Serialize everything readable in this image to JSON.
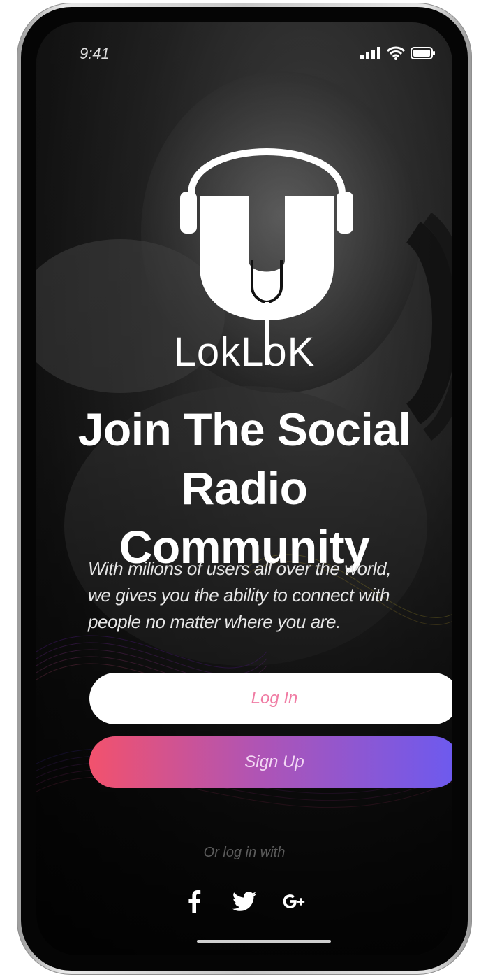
{
  "status_bar": {
    "time": "9:41",
    "icons": [
      "signal-icon",
      "wifi-icon",
      "battery-icon"
    ]
  },
  "logo": {
    "brand_name": "LokLoK",
    "icon": "headphones-microphone-logo"
  },
  "headline": {
    "line1": "Join The Social",
    "line2": "Radio Community"
  },
  "description": "With milions of users all over the world, we gives you the ability to connect with people no matter where you are.",
  "buttons": {
    "login_label": "Log In",
    "signup_label": "Sign Up"
  },
  "social_login": {
    "prompt": "Or log in with",
    "providers": [
      "facebook-icon",
      "twitter-icon",
      "google-plus-icon"
    ]
  },
  "colors": {
    "login_text": "#f07ba3",
    "signup_gradient_start": "#f2526d",
    "signup_gradient_end": "#6b5af0"
  }
}
